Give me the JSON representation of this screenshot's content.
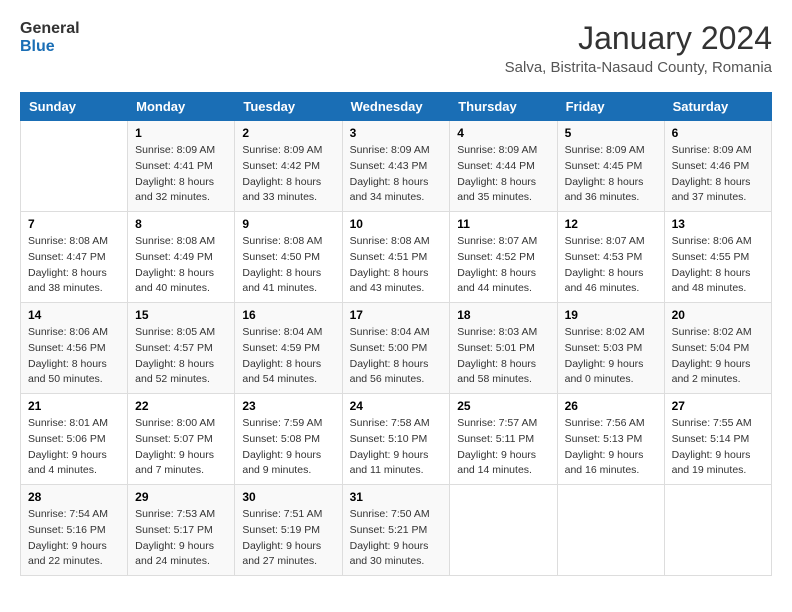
{
  "logo": {
    "text_general": "General",
    "text_blue": "Blue"
  },
  "header": {
    "month_year": "January 2024",
    "location": "Salva, Bistrita-Nasaud County, Romania"
  },
  "weekdays": [
    "Sunday",
    "Monday",
    "Tuesday",
    "Wednesday",
    "Thursday",
    "Friday",
    "Saturday"
  ],
  "weeks": [
    [
      {
        "day": "",
        "info": ""
      },
      {
        "day": "1",
        "info": "Sunrise: 8:09 AM\nSunset: 4:41 PM\nDaylight: 8 hours\nand 32 minutes."
      },
      {
        "day": "2",
        "info": "Sunrise: 8:09 AM\nSunset: 4:42 PM\nDaylight: 8 hours\nand 33 minutes."
      },
      {
        "day": "3",
        "info": "Sunrise: 8:09 AM\nSunset: 4:43 PM\nDaylight: 8 hours\nand 34 minutes."
      },
      {
        "day": "4",
        "info": "Sunrise: 8:09 AM\nSunset: 4:44 PM\nDaylight: 8 hours\nand 35 minutes."
      },
      {
        "day": "5",
        "info": "Sunrise: 8:09 AM\nSunset: 4:45 PM\nDaylight: 8 hours\nand 36 minutes."
      },
      {
        "day": "6",
        "info": "Sunrise: 8:09 AM\nSunset: 4:46 PM\nDaylight: 8 hours\nand 37 minutes."
      }
    ],
    [
      {
        "day": "7",
        "info": "Sunrise: 8:08 AM\nSunset: 4:47 PM\nDaylight: 8 hours\nand 38 minutes."
      },
      {
        "day": "8",
        "info": "Sunrise: 8:08 AM\nSunset: 4:49 PM\nDaylight: 8 hours\nand 40 minutes."
      },
      {
        "day": "9",
        "info": "Sunrise: 8:08 AM\nSunset: 4:50 PM\nDaylight: 8 hours\nand 41 minutes."
      },
      {
        "day": "10",
        "info": "Sunrise: 8:08 AM\nSunset: 4:51 PM\nDaylight: 8 hours\nand 43 minutes."
      },
      {
        "day": "11",
        "info": "Sunrise: 8:07 AM\nSunset: 4:52 PM\nDaylight: 8 hours\nand 44 minutes."
      },
      {
        "day": "12",
        "info": "Sunrise: 8:07 AM\nSunset: 4:53 PM\nDaylight: 8 hours\nand 46 minutes."
      },
      {
        "day": "13",
        "info": "Sunrise: 8:06 AM\nSunset: 4:55 PM\nDaylight: 8 hours\nand 48 minutes."
      }
    ],
    [
      {
        "day": "14",
        "info": "Sunrise: 8:06 AM\nSunset: 4:56 PM\nDaylight: 8 hours\nand 50 minutes."
      },
      {
        "day": "15",
        "info": "Sunrise: 8:05 AM\nSunset: 4:57 PM\nDaylight: 8 hours\nand 52 minutes."
      },
      {
        "day": "16",
        "info": "Sunrise: 8:04 AM\nSunset: 4:59 PM\nDaylight: 8 hours\nand 54 minutes."
      },
      {
        "day": "17",
        "info": "Sunrise: 8:04 AM\nSunset: 5:00 PM\nDaylight: 8 hours\nand 56 minutes."
      },
      {
        "day": "18",
        "info": "Sunrise: 8:03 AM\nSunset: 5:01 PM\nDaylight: 8 hours\nand 58 minutes."
      },
      {
        "day": "19",
        "info": "Sunrise: 8:02 AM\nSunset: 5:03 PM\nDaylight: 9 hours\nand 0 minutes."
      },
      {
        "day": "20",
        "info": "Sunrise: 8:02 AM\nSunset: 5:04 PM\nDaylight: 9 hours\nand 2 minutes."
      }
    ],
    [
      {
        "day": "21",
        "info": "Sunrise: 8:01 AM\nSunset: 5:06 PM\nDaylight: 9 hours\nand 4 minutes."
      },
      {
        "day": "22",
        "info": "Sunrise: 8:00 AM\nSunset: 5:07 PM\nDaylight: 9 hours\nand 7 minutes."
      },
      {
        "day": "23",
        "info": "Sunrise: 7:59 AM\nSunset: 5:08 PM\nDaylight: 9 hours\nand 9 minutes."
      },
      {
        "day": "24",
        "info": "Sunrise: 7:58 AM\nSunset: 5:10 PM\nDaylight: 9 hours\nand 11 minutes."
      },
      {
        "day": "25",
        "info": "Sunrise: 7:57 AM\nSunset: 5:11 PM\nDaylight: 9 hours\nand 14 minutes."
      },
      {
        "day": "26",
        "info": "Sunrise: 7:56 AM\nSunset: 5:13 PM\nDaylight: 9 hours\nand 16 minutes."
      },
      {
        "day": "27",
        "info": "Sunrise: 7:55 AM\nSunset: 5:14 PM\nDaylight: 9 hours\nand 19 minutes."
      }
    ],
    [
      {
        "day": "28",
        "info": "Sunrise: 7:54 AM\nSunset: 5:16 PM\nDaylight: 9 hours\nand 22 minutes."
      },
      {
        "day": "29",
        "info": "Sunrise: 7:53 AM\nSunset: 5:17 PM\nDaylight: 9 hours\nand 24 minutes."
      },
      {
        "day": "30",
        "info": "Sunrise: 7:51 AM\nSunset: 5:19 PM\nDaylight: 9 hours\nand 27 minutes."
      },
      {
        "day": "31",
        "info": "Sunrise: 7:50 AM\nSunset: 5:21 PM\nDaylight: 9 hours\nand 30 minutes."
      },
      {
        "day": "",
        "info": ""
      },
      {
        "day": "",
        "info": ""
      },
      {
        "day": "",
        "info": ""
      }
    ]
  ]
}
